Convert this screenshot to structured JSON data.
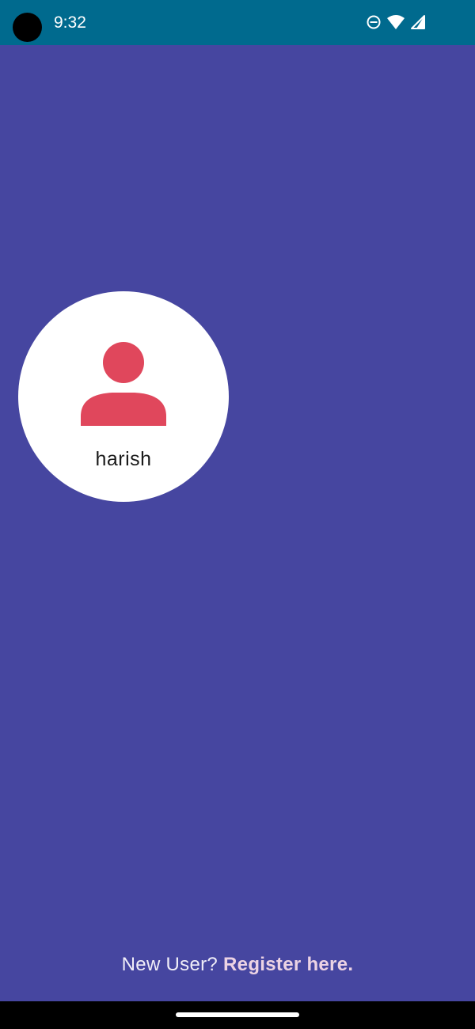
{
  "status_bar": {
    "time": "9:32",
    "icons": [
      "do-not-disturb-icon",
      "wifi-icon",
      "signal-icon"
    ]
  },
  "profile": {
    "name": "harish",
    "avatar_icon": "person-icon",
    "avatar_color": "#e0475c"
  },
  "footer": {
    "prompt": "New User? ",
    "link": "Register here."
  },
  "colors": {
    "background": "#4646a0",
    "status_bar": "#006a8e",
    "link": "#ecd3e4"
  }
}
